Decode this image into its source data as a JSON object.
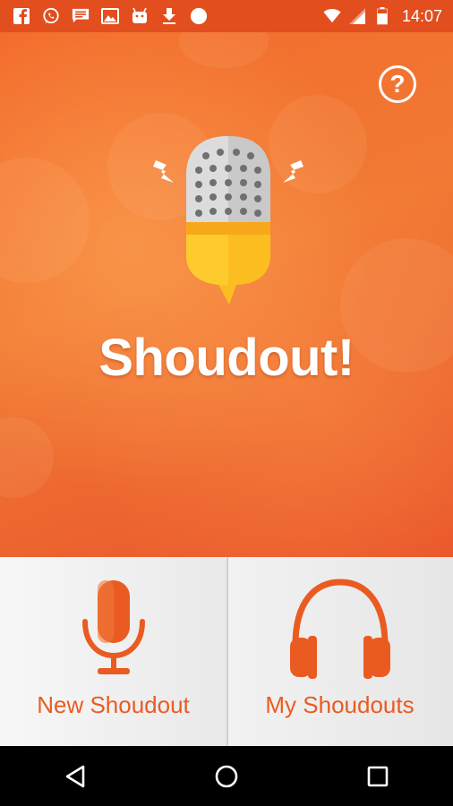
{
  "status_bar": {
    "time": "14:07",
    "notification_icons": [
      "facebook-icon",
      "whatsapp-icon",
      "message-icon",
      "image-icon",
      "android-icon",
      "download-icon",
      "circle-icon"
    ],
    "system_icons": [
      "wifi-icon",
      "signal-icon",
      "battery-icon"
    ]
  },
  "hero": {
    "title": "Shoudout!",
    "help_label": "?",
    "accent_color": "#f06a2b"
  },
  "actions": {
    "new_label": "New Shoudout",
    "my_label": "My Shoudouts"
  },
  "nav": {
    "back_icon": "back-triangle-icon",
    "home_icon": "home-circle-icon",
    "recents_icon": "recents-square-icon"
  }
}
